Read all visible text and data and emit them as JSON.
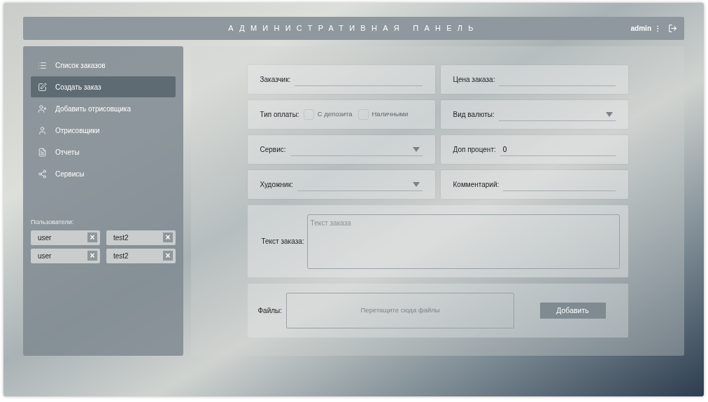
{
  "header": {
    "title": "АДМИНИСТРАТИВНАЯ ПАНЕЛЬ",
    "user": "admin"
  },
  "sidebar": {
    "items": [
      {
        "label": "Список заказов",
        "selected": false
      },
      {
        "label": "Создать заказ",
        "selected": true
      },
      {
        "label": "Добавить отрисовщика",
        "selected": false
      },
      {
        "label": "Отрисовщики",
        "selected": false
      },
      {
        "label": "Отчеты",
        "selected": false
      },
      {
        "label": "Сервисы",
        "selected": false
      }
    ],
    "users_label": "Пользователи:",
    "users": [
      {
        "name": "user",
        "remove": "×"
      },
      {
        "name": "test2",
        "remove": "×"
      },
      {
        "name": "user",
        "remove": "×"
      },
      {
        "name": "test2",
        "remove": "×"
      }
    ]
  },
  "form": {
    "fields": [
      {
        "kind": "text",
        "label": "Заказчик:"
      },
      {
        "kind": "text",
        "label": "Цена заказа:"
      },
      {
        "kind": "checkboxes",
        "label": "Тип оплаты:",
        "options": [
          {
            "label": "С депозита",
            "checked": false
          },
          {
            "label": "Наличными",
            "checked": false
          }
        ]
      },
      {
        "kind": "select",
        "label": "Вид валюты:"
      },
      {
        "kind": "select",
        "label": "Сервис:"
      },
      {
        "kind": "text",
        "label": "Доп процент:",
        "value": "0"
      },
      {
        "kind": "select",
        "label": "Художник:"
      },
      {
        "kind": "text",
        "label": "Комментарий:"
      }
    ],
    "order_text": {
      "label": "Текст заказа:",
      "placeholder": "Текст заказа"
    },
    "files": {
      "label": "Файлы:",
      "placeholder": "Перетащите сюда файлы",
      "button": "Добавить"
    }
  }
}
